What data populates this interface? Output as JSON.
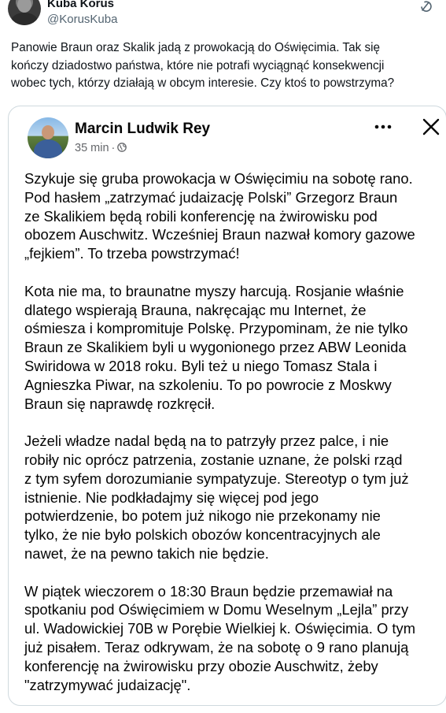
{
  "tweet": {
    "author_name": "Kuba Korus",
    "author_handle": "@KorusKuba",
    "text": "Panowie Braun oraz Skalik jadą z prowokacją do Oświęcimia. Tak się\nkończy dziadostwo państwa, które nie potrafi wyciągnąć konsekwencji\nwobec tych, którzy działają w obcym interesie. Czy ktoś to powstrzyma?"
  },
  "quoted_post": {
    "author_name": "Marcin Ludwik Rey",
    "time": "35 min",
    "separator": "·",
    "paragraphs": [
      "Szykuje się gruba prowokacja w Oświęcimiu na sobotę rano.\nPod hasłem „zatrzymać judaizację Polski” Grzegorz Braun\nze Skalikiem będą robili konferencję na żwirowisku pod\nobozem Auschwitz. Wcześniej Braun nazwał komory gazowe\n„fejkiem”. To trzeba powstrzymać!",
      "Kota nie ma, to braunatne myszy harcują. Rosjanie właśnie\ndlatego wspierają Brauna, nakręcając mu Internet, że\nośmiesza i kompromituje Polskę. Przypominam, że nie tylko\nBraun ze Skalikiem byli u wygonionego przez ABW Leonida\nSwiridowa w 2018 roku. Byli też u niego Tomasz Stala i\nAgnieszka Piwar, na szkoleniu. To po powrocie z Moskwy\nBraun się naprawdę rozkręcił.",
      "Jeżeli władze nadal będą na to patrzyły przez palce, i nie\nrobiły nic oprócz patrzenia, zostanie uznane, że polski rząd\nz tym syfem dorozumianie sympatyzuje. Stereotyp o tym już\nistnienie. Nie podkładajmy się więcej pod jego\npotwierdzenie, bo potem już nikogo nie przekonamy nie\ntylko, że nie było polskich obozów koncentracyjnych ale\nnawet, że na pewno takich nie będzie.",
      "W piątek wieczorem o 18:30 Braun będzie przemawiał na\nspotkaniu pod Oświęcimiem w Domu Weselnym „Lejla” przy\nul. Wadowickiej 70B w Porębie Wielkiej k. Oświęcimia. O tym\njuż pisałem. Teraz odkrywam, że na sobotę o 9 rano planują\nkonferencję na żwirowisku przy obozie Auschwitz, żeby\n\"zatrzymywać judaizację\"."
    ]
  },
  "icons": {
    "grok": "grok-icon",
    "globe": "globe-icon",
    "more": "more-icon",
    "close": "close-icon"
  },
  "colors": {
    "secondary_text": "#536471",
    "card_border": "#cfd9de",
    "fb_secondary": "#65676b"
  }
}
